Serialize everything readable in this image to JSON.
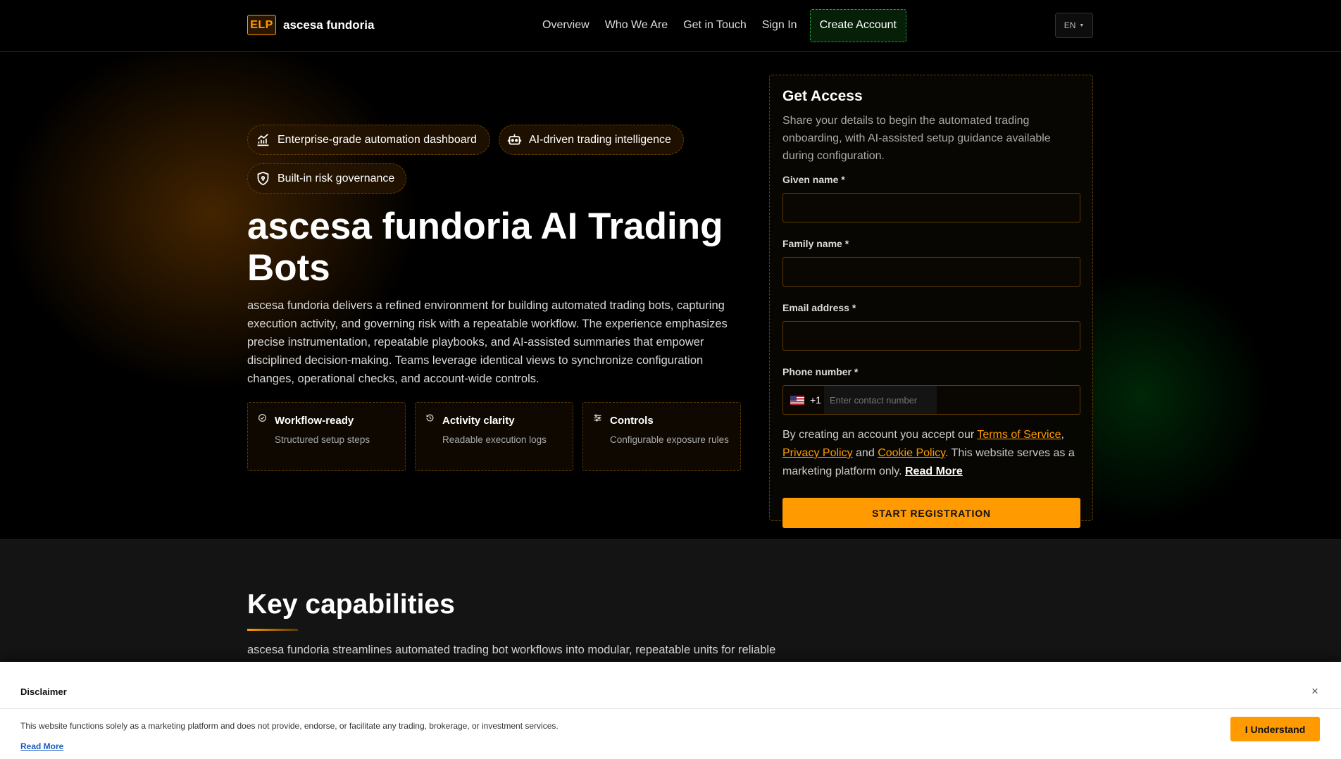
{
  "header": {
    "logo_mark": "ELP",
    "logo_text": "ascesa fundoria",
    "nav": [
      "Overview",
      "Who We Are",
      "Get in Touch",
      "Sign In"
    ],
    "cta": "Create Account",
    "language": "EN"
  },
  "hero": {
    "pills": [
      {
        "label": "Enterprise-grade automation dashboard",
        "icon": "chart-icon"
      },
      {
        "label": "AI-driven trading intelligence",
        "icon": "robot-icon"
      },
      {
        "label": "Built-in risk governance",
        "icon": "shield-icon"
      }
    ],
    "title": "ascesa fundoria AI Trading Bots",
    "description": "ascesa fundoria delivers a refined environment for building automated trading bots, capturing execution activity, and governing risk with a repeatable workflow. The experience emphasizes precise instrumentation, repeatable playbooks, and AI-assisted summaries that empower disciplined decision-making. Teams leverage identical views to synchronize configuration changes, operational checks, and account-wide controls.",
    "cards": [
      {
        "title": "Workflow-ready",
        "subtitle": "Structured setup steps",
        "icon": "check-circle-icon"
      },
      {
        "title": "Activity clarity",
        "subtitle": "Readable execution logs",
        "icon": "history-icon"
      },
      {
        "title": "Controls",
        "subtitle": "Configurable exposure rules",
        "icon": "sliders-icon"
      }
    ]
  },
  "form": {
    "title": "Get Access",
    "description": "Share your details to begin the automated trading onboarding, with AI-assisted setup guidance available during configuration.",
    "given_name_label": "Given name *",
    "family_name_label": "Family name *",
    "email_label": "Email address *",
    "phone_label": "Phone number *",
    "dial_code": "+1",
    "phone_placeholder": "Enter contact number",
    "terms_prefix": "By creating an account you accept our",
    "terms_link": "Terms of Service",
    "privacy_link": "Privacy Policy",
    "and": "and",
    "cookie_link": "Cookie Policy",
    "terms_suffix": ". This website serves as a marketing platform only.",
    "read_more": "Read More",
    "submit": "START REGISTRATION"
  },
  "capabilities": {
    "title": "Key capabilities",
    "description": "ascesa fundoria streamlines automated trading bot workflows into modular, repeatable units for reliable"
  },
  "disclaimer": {
    "title": "Disclaimer",
    "close": "×",
    "text": "This website functions solely as a marketing platform and does not provide, endorse, or facilitate any trading, brokerage, or investment services.",
    "read_more": "Read More",
    "button": "I Understand"
  },
  "colors": {
    "accent": "#ff9a00",
    "cta_green": "#2a9a3a",
    "background": "#000000"
  }
}
